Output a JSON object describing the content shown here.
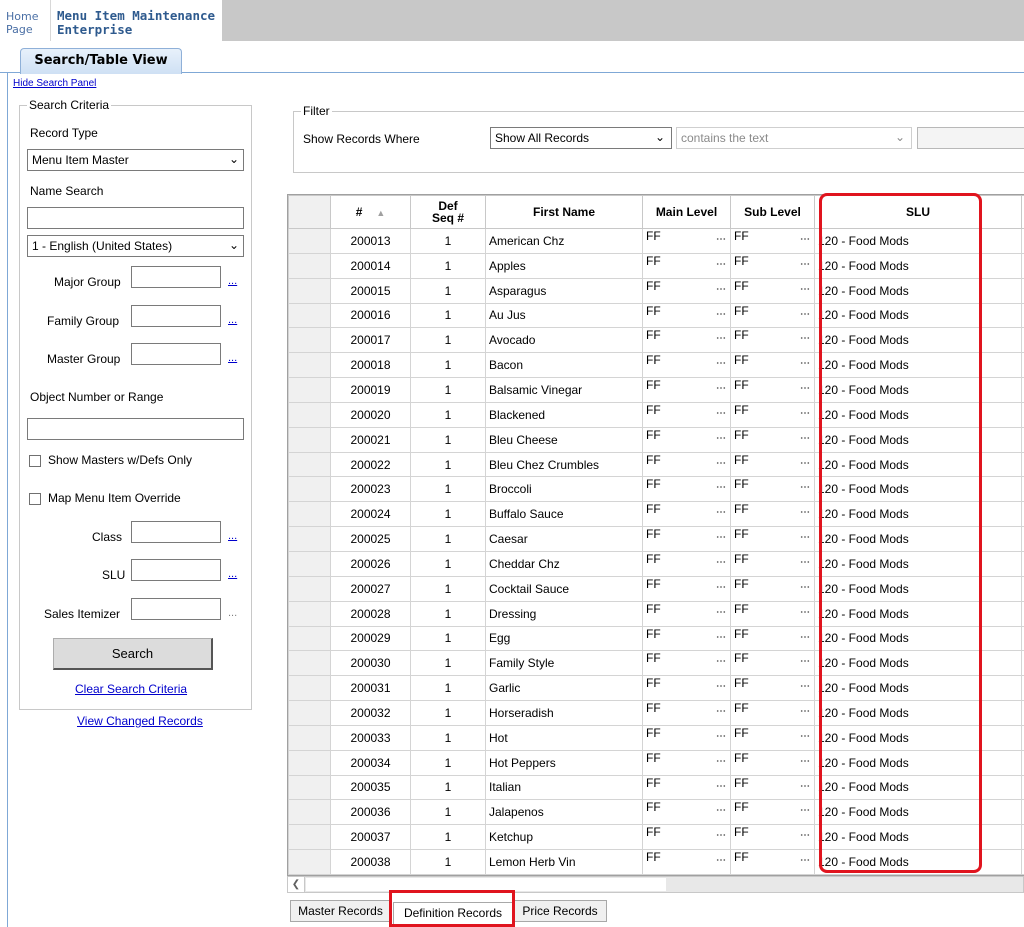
{
  "header": {
    "home_line1": "Home",
    "home_line2": "Page",
    "app_line1": "Menu Item Maintenance",
    "app_line2": "Enterprise"
  },
  "tab": {
    "label": "Search/Table View"
  },
  "hide_search_panel": "Hide Search Panel",
  "search": {
    "title": "Search Criteria",
    "record_type_label": "Record Type",
    "record_type_value": "Menu Item Master",
    "name_search_label": "Name Search",
    "name_search_value": "",
    "language_value": "1 - English (United States)",
    "major_group_label": "Major Group",
    "family_group_label": "Family Group",
    "master_group_label": "Master Group",
    "object_number_label": "Object Number or Range",
    "show_masters_label": "Show Masters w/Defs Only",
    "map_override_label": "Map Menu Item Override",
    "class_label": "Class",
    "slu_label": "SLU",
    "sales_itemizer_label": "Sales Itemizer",
    "ellipsis": "...",
    "search_button": "Search",
    "clear_link": "Clear Search Criteria",
    "view_changed_link": "View Changed Records"
  },
  "filter": {
    "title": "Filter",
    "show_records_where": "Show Records Where",
    "select_value": "Show All Records",
    "condition_value": "contains the text"
  },
  "grid": {
    "headers": {
      "num": "#",
      "def_seq_1": "Def",
      "def_seq_2": "Seq #",
      "first_name": "First Name",
      "main_level": "Main Level",
      "sub_level": "Sub Level",
      "slu": "SLU"
    },
    "dots": "⋯",
    "rows": [
      {
        "num": "200013",
        "seq": "1",
        "name": "American Chz",
        "main": "FF",
        "sub": "FF",
        "slu": "120 - Food Mods"
      },
      {
        "num": "200014",
        "seq": "1",
        "name": "Apples",
        "main": "FF",
        "sub": "FF",
        "slu": "120 - Food Mods"
      },
      {
        "num": "200015",
        "seq": "1",
        "name": "Asparagus",
        "main": "FF",
        "sub": "FF",
        "slu": "120 - Food Mods"
      },
      {
        "num": "200016",
        "seq": "1",
        "name": "Au Jus",
        "main": "FF",
        "sub": "FF",
        "slu": "120 - Food Mods"
      },
      {
        "num": "200017",
        "seq": "1",
        "name": "Avocado",
        "main": "FF",
        "sub": "FF",
        "slu": "120 - Food Mods"
      },
      {
        "num": "200018",
        "seq": "1",
        "name": "Bacon",
        "main": "FF",
        "sub": "FF",
        "slu": "120 - Food Mods"
      },
      {
        "num": "200019",
        "seq": "1",
        "name": "Balsamic Vinegar",
        "main": "FF",
        "sub": "FF",
        "slu": "120 - Food Mods"
      },
      {
        "num": "200020",
        "seq": "1",
        "name": "Blackened",
        "main": "FF",
        "sub": "FF",
        "slu": "120 - Food Mods"
      },
      {
        "num": "200021",
        "seq": "1",
        "name": "Bleu Cheese",
        "main": "FF",
        "sub": "FF",
        "slu": "120 - Food Mods"
      },
      {
        "num": "200022",
        "seq": "1",
        "name": "Bleu Chez Crumbles",
        "main": "FF",
        "sub": "FF",
        "slu": "120 - Food Mods"
      },
      {
        "num": "200023",
        "seq": "1",
        "name": "Broccoli",
        "main": "FF",
        "sub": "FF",
        "slu": "120 - Food Mods"
      },
      {
        "num": "200024",
        "seq": "1",
        "name": "Buffalo Sauce",
        "main": "FF",
        "sub": "FF",
        "slu": "120 - Food Mods"
      },
      {
        "num": "200025",
        "seq": "1",
        "name": "Caesar",
        "main": "FF",
        "sub": "FF",
        "slu": "120 - Food Mods"
      },
      {
        "num": "200026",
        "seq": "1",
        "name": "Cheddar Chz",
        "main": "FF",
        "sub": "FF",
        "slu": "120 - Food Mods"
      },
      {
        "num": "200027",
        "seq": "1",
        "name": "Cocktail Sauce",
        "main": "FF",
        "sub": "FF",
        "slu": "120 - Food Mods"
      },
      {
        "num": "200028",
        "seq": "1",
        "name": "Dressing",
        "main": "FF",
        "sub": "FF",
        "slu": "120 - Food Mods"
      },
      {
        "num": "200029",
        "seq": "1",
        "name": "Egg",
        "main": "FF",
        "sub": "FF",
        "slu": "120 - Food Mods"
      },
      {
        "num": "200030",
        "seq": "1",
        "name": "Family Style",
        "main": "FF",
        "sub": "FF",
        "slu": "120 - Food Mods"
      },
      {
        "num": "200031",
        "seq": "1",
        "name": "Garlic",
        "main": "FF",
        "sub": "FF",
        "slu": "120 - Food Mods"
      },
      {
        "num": "200032",
        "seq": "1",
        "name": "Horseradish",
        "main": "FF",
        "sub": "FF",
        "slu": "120 - Food Mods"
      },
      {
        "num": "200033",
        "seq": "1",
        "name": "Hot",
        "main": "FF",
        "sub": "FF",
        "slu": "120 - Food Mods"
      },
      {
        "num": "200034",
        "seq": "1",
        "name": "Hot Peppers",
        "main": "FF",
        "sub": "FF",
        "slu": "120 - Food Mods"
      },
      {
        "num": "200035",
        "seq": "1",
        "name": "Italian",
        "main": "FF",
        "sub": "FF",
        "slu": "120 - Food Mods"
      },
      {
        "num": "200036",
        "seq": "1",
        "name": "Jalapenos",
        "main": "FF",
        "sub": "FF",
        "slu": "120 - Food Mods"
      },
      {
        "num": "200037",
        "seq": "1",
        "name": "Ketchup",
        "main": "FF",
        "sub": "FF",
        "slu": "120 - Food Mods"
      },
      {
        "num": "200038",
        "seq": "1",
        "name": "Lemon Herb Vin",
        "main": "FF",
        "sub": "FF",
        "slu": "120 - Food Mods"
      }
    ]
  },
  "bottom_tabs": {
    "master": "Master Records",
    "definition": "Definition Records",
    "price": "Price Records"
  },
  "colors": {
    "highlight": "#e0141e",
    "link": "#0000cc",
    "tab_border": "#7fa8d6"
  }
}
